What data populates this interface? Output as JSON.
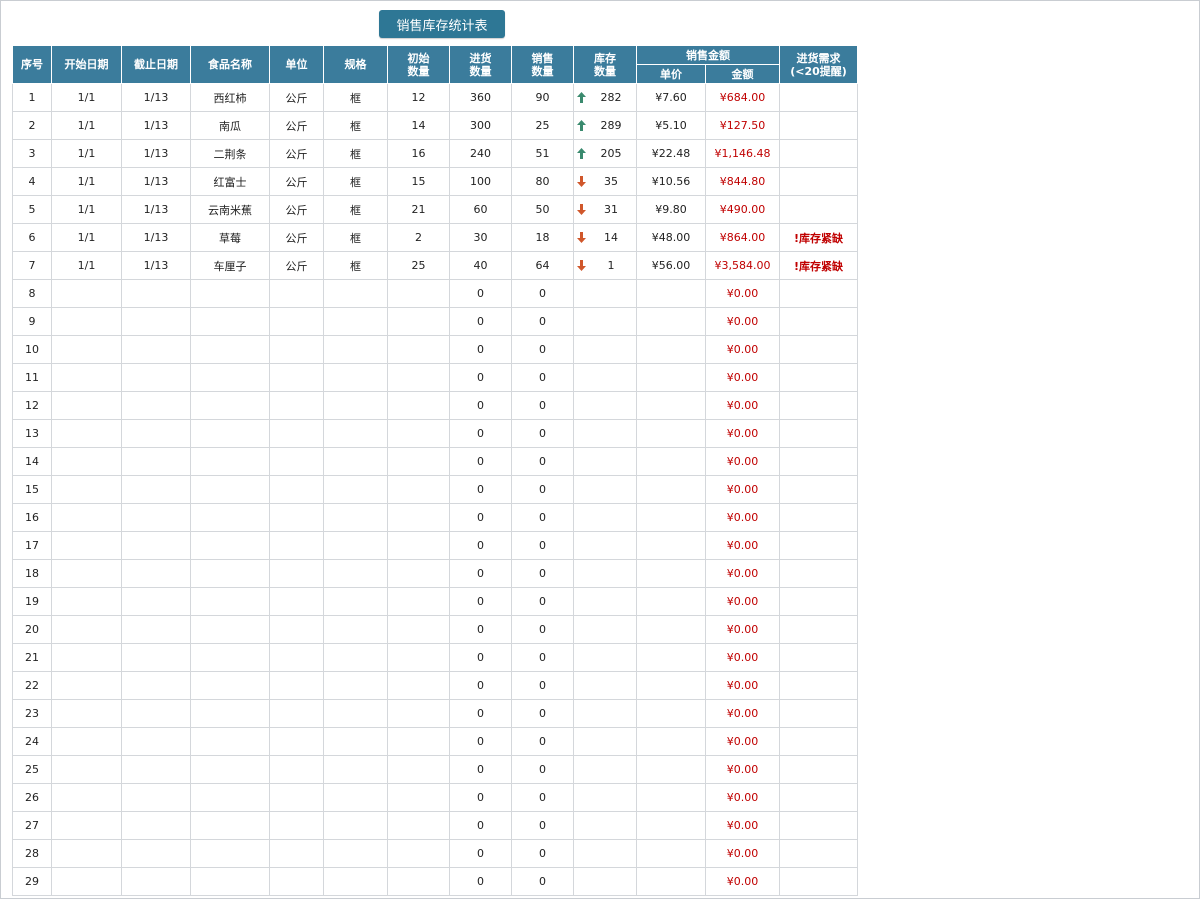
{
  "title": "销售库存统计表",
  "headers": {
    "seq": "序号",
    "start": "开始日期",
    "end": "截止日期",
    "name": "食品名称",
    "unit": "单位",
    "spec": "规格",
    "init_l1": "初始",
    "init_l2": "数量",
    "purchase_l1": "进货",
    "purchase_l2": "数量",
    "sales_l1": "销售",
    "sales_l2": "数量",
    "stock_l1": "库存",
    "stock_l2": "数量",
    "amount_group": "销售金额",
    "price": "单价",
    "amount": "金额",
    "need_l1": "进货需求",
    "need_l2": "(<20提醒)"
  },
  "colors": {
    "header_bg": "#3b7c9c",
    "title_bg": "#2e7795",
    "up_arrow": "#3a8a6e",
    "down_arrow": "#d0572b",
    "red_text": "#c00000"
  },
  "rows": [
    {
      "seq": "1",
      "start": "1/1",
      "end": "1/13",
      "name": "西红柿",
      "unit": "公斤",
      "spec": "框",
      "init": "12",
      "purchase": "360",
      "sales": "90",
      "trend": "up",
      "stock": "282",
      "price": "¥7.60",
      "amount": "¥684.00",
      "need": ""
    },
    {
      "seq": "2",
      "start": "1/1",
      "end": "1/13",
      "name": "南瓜",
      "unit": "公斤",
      "spec": "框",
      "init": "14",
      "purchase": "300",
      "sales": "25",
      "trend": "up",
      "stock": "289",
      "price": "¥5.10",
      "amount": "¥127.50",
      "need": ""
    },
    {
      "seq": "3",
      "start": "1/1",
      "end": "1/13",
      "name": "二荆条",
      "unit": "公斤",
      "spec": "框",
      "init": "16",
      "purchase": "240",
      "sales": "51",
      "trend": "up",
      "stock": "205",
      "price": "¥22.48",
      "amount": "¥1,146.48",
      "need": ""
    },
    {
      "seq": "4",
      "start": "1/1",
      "end": "1/13",
      "name": "红富士",
      "unit": "公斤",
      "spec": "框",
      "init": "15",
      "purchase": "100",
      "sales": "80",
      "trend": "down",
      "stock": "35",
      "price": "¥10.56",
      "amount": "¥844.80",
      "need": ""
    },
    {
      "seq": "5",
      "start": "1/1",
      "end": "1/13",
      "name": "云南米蕉",
      "unit": "公斤",
      "spec": "框",
      "init": "21",
      "purchase": "60",
      "sales": "50",
      "trend": "down",
      "stock": "31",
      "price": "¥9.80",
      "amount": "¥490.00",
      "need": ""
    },
    {
      "seq": "6",
      "start": "1/1",
      "end": "1/13",
      "name": "草莓",
      "unit": "公斤",
      "spec": "框",
      "init": "2",
      "purchase": "30",
      "sales": "18",
      "trend": "down",
      "stock": "14",
      "price": "¥48.00",
      "amount": "¥864.00",
      "need": "!库存紧缺"
    },
    {
      "seq": "7",
      "start": "1/1",
      "end": "1/13",
      "name": "车厘子",
      "unit": "公斤",
      "spec": "框",
      "init": "25",
      "purchase": "40",
      "sales": "64",
      "trend": "down",
      "stock": "1",
      "price": "¥56.00",
      "amount": "¥3,584.00",
      "need": "!库存紧缺"
    },
    {
      "seq": "8",
      "start": "",
      "end": "",
      "name": "",
      "unit": "",
      "spec": "",
      "init": "",
      "purchase": "0",
      "sales": "0",
      "trend": "",
      "stock": "",
      "price": "",
      "amount": "¥0.00",
      "need": ""
    },
    {
      "seq": "9",
      "start": "",
      "end": "",
      "name": "",
      "unit": "",
      "spec": "",
      "init": "",
      "purchase": "0",
      "sales": "0",
      "trend": "",
      "stock": "",
      "price": "",
      "amount": "¥0.00",
      "need": ""
    },
    {
      "seq": "10",
      "start": "",
      "end": "",
      "name": "",
      "unit": "",
      "spec": "",
      "init": "",
      "purchase": "0",
      "sales": "0",
      "trend": "",
      "stock": "",
      "price": "",
      "amount": "¥0.00",
      "need": ""
    },
    {
      "seq": "11",
      "start": "",
      "end": "",
      "name": "",
      "unit": "",
      "spec": "",
      "init": "",
      "purchase": "0",
      "sales": "0",
      "trend": "",
      "stock": "",
      "price": "",
      "amount": "¥0.00",
      "need": ""
    },
    {
      "seq": "12",
      "start": "",
      "end": "",
      "name": "",
      "unit": "",
      "spec": "",
      "init": "",
      "purchase": "0",
      "sales": "0",
      "trend": "",
      "stock": "",
      "price": "",
      "amount": "¥0.00",
      "need": ""
    },
    {
      "seq": "13",
      "start": "",
      "end": "",
      "name": "",
      "unit": "",
      "spec": "",
      "init": "",
      "purchase": "0",
      "sales": "0",
      "trend": "",
      "stock": "",
      "price": "",
      "amount": "¥0.00",
      "need": ""
    },
    {
      "seq": "14",
      "start": "",
      "end": "",
      "name": "",
      "unit": "",
      "spec": "",
      "init": "",
      "purchase": "0",
      "sales": "0",
      "trend": "",
      "stock": "",
      "price": "",
      "amount": "¥0.00",
      "need": ""
    },
    {
      "seq": "15",
      "start": "",
      "end": "",
      "name": "",
      "unit": "",
      "spec": "",
      "init": "",
      "purchase": "0",
      "sales": "0",
      "trend": "",
      "stock": "",
      "price": "",
      "amount": "¥0.00",
      "need": ""
    },
    {
      "seq": "16",
      "start": "",
      "end": "",
      "name": "",
      "unit": "",
      "spec": "",
      "init": "",
      "purchase": "0",
      "sales": "0",
      "trend": "",
      "stock": "",
      "price": "",
      "amount": "¥0.00",
      "need": ""
    },
    {
      "seq": "17",
      "start": "",
      "end": "",
      "name": "",
      "unit": "",
      "spec": "",
      "init": "",
      "purchase": "0",
      "sales": "0",
      "trend": "",
      "stock": "",
      "price": "",
      "amount": "¥0.00",
      "need": ""
    },
    {
      "seq": "18",
      "start": "",
      "end": "",
      "name": "",
      "unit": "",
      "spec": "",
      "init": "",
      "purchase": "0",
      "sales": "0",
      "trend": "",
      "stock": "",
      "price": "",
      "amount": "¥0.00",
      "need": ""
    },
    {
      "seq": "19",
      "start": "",
      "end": "",
      "name": "",
      "unit": "",
      "spec": "",
      "init": "",
      "purchase": "0",
      "sales": "0",
      "trend": "",
      "stock": "",
      "price": "",
      "amount": "¥0.00",
      "need": ""
    },
    {
      "seq": "20",
      "start": "",
      "end": "",
      "name": "",
      "unit": "",
      "spec": "",
      "init": "",
      "purchase": "0",
      "sales": "0",
      "trend": "",
      "stock": "",
      "price": "",
      "amount": "¥0.00",
      "need": ""
    },
    {
      "seq": "21",
      "start": "",
      "end": "",
      "name": "",
      "unit": "",
      "spec": "",
      "init": "",
      "purchase": "0",
      "sales": "0",
      "trend": "",
      "stock": "",
      "price": "",
      "amount": "¥0.00",
      "need": ""
    },
    {
      "seq": "22",
      "start": "",
      "end": "",
      "name": "",
      "unit": "",
      "spec": "",
      "init": "",
      "purchase": "0",
      "sales": "0",
      "trend": "",
      "stock": "",
      "price": "",
      "amount": "¥0.00",
      "need": ""
    },
    {
      "seq": "23",
      "start": "",
      "end": "",
      "name": "",
      "unit": "",
      "spec": "",
      "init": "",
      "purchase": "0",
      "sales": "0",
      "trend": "",
      "stock": "",
      "price": "",
      "amount": "¥0.00",
      "need": ""
    },
    {
      "seq": "24",
      "start": "",
      "end": "",
      "name": "",
      "unit": "",
      "spec": "",
      "init": "",
      "purchase": "0",
      "sales": "0",
      "trend": "",
      "stock": "",
      "price": "",
      "amount": "¥0.00",
      "need": ""
    },
    {
      "seq": "25",
      "start": "",
      "end": "",
      "name": "",
      "unit": "",
      "spec": "",
      "init": "",
      "purchase": "0",
      "sales": "0",
      "trend": "",
      "stock": "",
      "price": "",
      "amount": "¥0.00",
      "need": ""
    },
    {
      "seq": "26",
      "start": "",
      "end": "",
      "name": "",
      "unit": "",
      "spec": "",
      "init": "",
      "purchase": "0",
      "sales": "0",
      "trend": "",
      "stock": "",
      "price": "",
      "amount": "¥0.00",
      "need": ""
    },
    {
      "seq": "27",
      "start": "",
      "end": "",
      "name": "",
      "unit": "",
      "spec": "",
      "init": "",
      "purchase": "0",
      "sales": "0",
      "trend": "",
      "stock": "",
      "price": "",
      "amount": "¥0.00",
      "need": ""
    },
    {
      "seq": "28",
      "start": "",
      "end": "",
      "name": "",
      "unit": "",
      "spec": "",
      "init": "",
      "purchase": "0",
      "sales": "0",
      "trend": "",
      "stock": "",
      "price": "",
      "amount": "¥0.00",
      "need": ""
    },
    {
      "seq": "29",
      "start": "",
      "end": "",
      "name": "",
      "unit": "",
      "spec": "",
      "init": "",
      "purchase": "0",
      "sales": "0",
      "trend": "",
      "stock": "",
      "price": "",
      "amount": "¥0.00",
      "need": ""
    }
  ]
}
